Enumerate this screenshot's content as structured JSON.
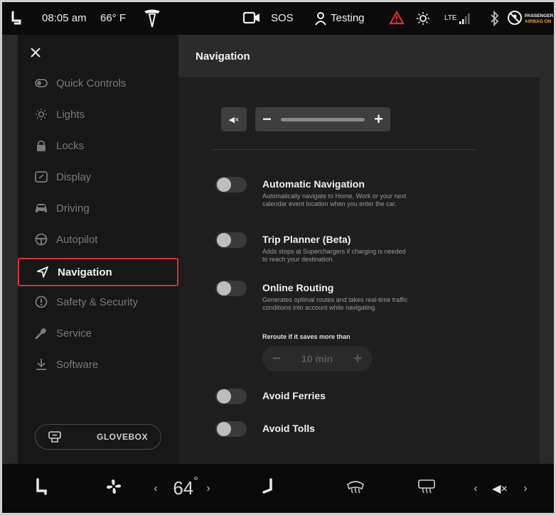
{
  "status_bar": {
    "time": "08:05 am",
    "temperature": "66° F",
    "sos": "SOS",
    "profile_name": "Testing",
    "lte": "LTE",
    "airbag_line1": "PASSENGER",
    "airbag_line2": "AIRBAG ON"
  },
  "sidebar": {
    "items": [
      {
        "label": "Quick Controls",
        "icon": "toggle-icon"
      },
      {
        "label": "Lights",
        "icon": "light-icon"
      },
      {
        "label": "Locks",
        "icon": "lock-icon"
      },
      {
        "label": "Display",
        "icon": "display-icon"
      },
      {
        "label": "Driving",
        "icon": "car-icon"
      },
      {
        "label": "Autopilot",
        "icon": "steering-wheel-icon"
      },
      {
        "label": "Navigation",
        "icon": "navigation-arrow-icon"
      },
      {
        "label": "Safety & Security",
        "icon": "alert-circle-icon"
      },
      {
        "label": "Service",
        "icon": "wrench-icon"
      },
      {
        "label": "Software",
        "icon": "download-icon"
      }
    ],
    "active_item": "Navigation",
    "glovebox_label": "GLOVEBOX"
  },
  "content": {
    "title": "Navigation",
    "volume": {
      "mute_symbol": "◀×",
      "minus": "−",
      "plus": "+",
      "level": 0
    },
    "settings": [
      {
        "title": "Automatic Navigation",
        "description": "Automatically navigate to Home, Work or your next calendar event location when you enter the car.",
        "enabled": false
      },
      {
        "title": "Trip Planner (Beta)",
        "description": "Adds stops at Superchargers if charging is needed to reach your destination.",
        "enabled": false
      },
      {
        "title": "Online Routing",
        "description": "Generates optimal routes and takes real-time traffic conditions into account while navigating.",
        "enabled": false
      },
      {
        "title": "Avoid Ferries",
        "description": "",
        "enabled": false
      },
      {
        "title": "Avoid Tolls",
        "description": "",
        "enabled": false
      }
    ],
    "reroute": {
      "label": "Reroute if it saves more than",
      "value": "10 min",
      "minus": "−",
      "plus": "+"
    }
  },
  "bottom_bar": {
    "temperature": "64",
    "degree": "°",
    "left_chevron": "‹",
    "right_chevron": "›",
    "volume_symbol": "◀×"
  }
}
